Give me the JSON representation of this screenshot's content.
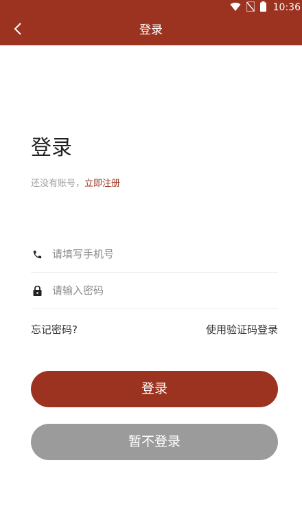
{
  "colors": {
    "brand": "#9b3320",
    "secondary_button": "#9b9b9b",
    "hint_text": "#a0a0a0"
  },
  "status_bar": {
    "time": "10:36",
    "icons": [
      "wifi-icon",
      "no-sim-icon",
      "battery-icon"
    ]
  },
  "app_bar": {
    "title": "登录",
    "back_icon": "chevron-left-icon"
  },
  "heading": "登录",
  "register_prompt": {
    "text": "还没有账号，",
    "link": "立即注册"
  },
  "fields": {
    "phone": {
      "icon": "phone-icon",
      "placeholder": "请填写手机号",
      "value": ""
    },
    "password": {
      "icon": "lock-icon",
      "placeholder": "请输入密码",
      "value": ""
    }
  },
  "links": {
    "forgot": "忘记密码?",
    "code_login": "使用验证码登录"
  },
  "buttons": {
    "login": "登录",
    "skip": "暂不登录"
  }
}
